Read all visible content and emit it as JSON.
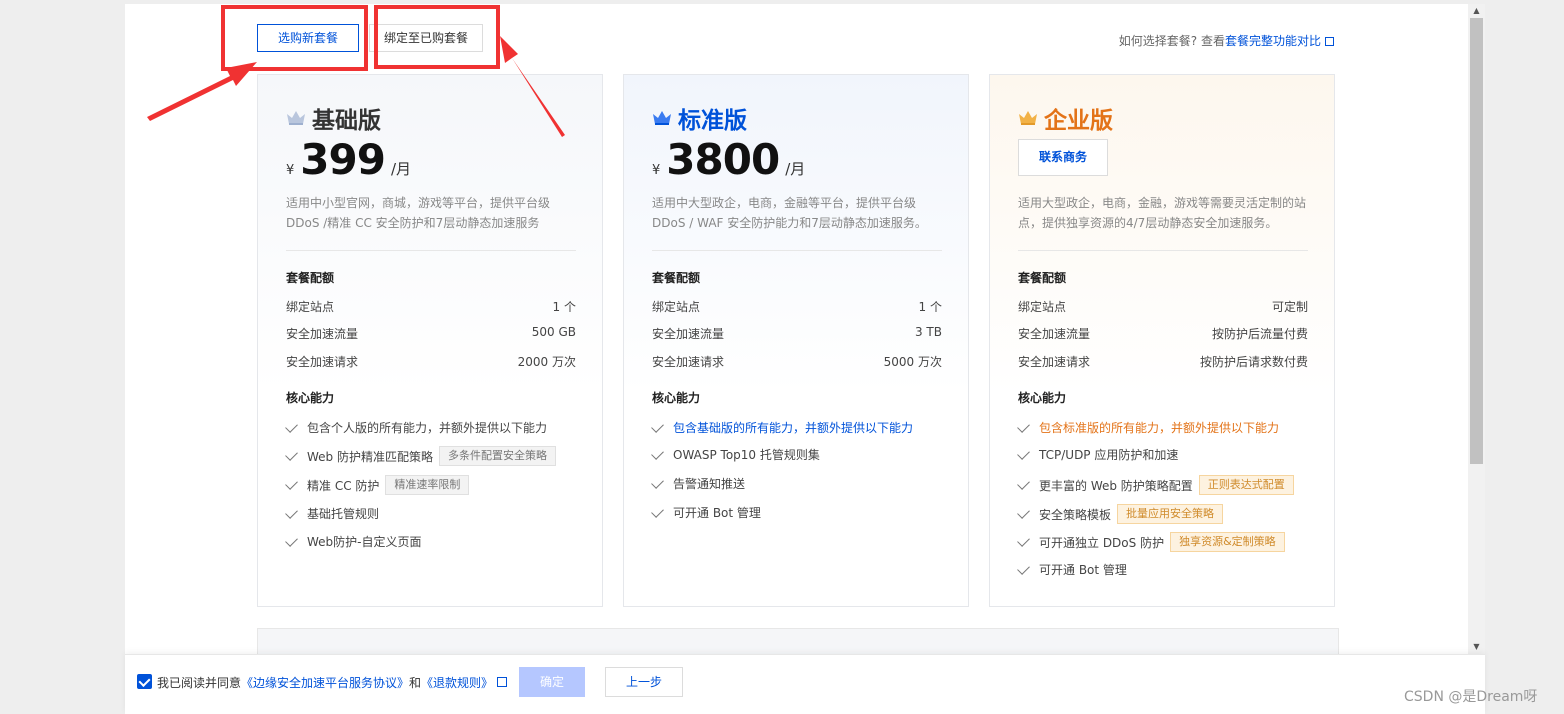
{
  "tabs": {
    "new_plan": "选购新套餐",
    "bind_plan": "绑定至已购套餐"
  },
  "help": {
    "prefix": "如何选择套餐? 查看",
    "link": "套餐完整功能对比"
  },
  "plans": [
    {
      "name": "基础版",
      "currency": "¥",
      "price": "399",
      "unit": "/月",
      "desc": "适用中小型官网，商城，游戏等平台，提供平台级 DDoS /精准 CC 安全防护和7层动静态加速服务",
      "quota_title": "套餐配额",
      "quota": [
        {
          "label": "绑定站点",
          "value": "1 个"
        },
        {
          "label": "安全加速流量",
          "value": "500 GB"
        },
        {
          "label": "安全加速请求",
          "value": "2000 万次"
        }
      ],
      "feature_title": "核心能力",
      "features": [
        {
          "text": "包含个人版的所有能力，并额外提供以下能力",
          "tag": ""
        },
        {
          "text": "Web 防护精准匹配策略",
          "tag": "多条件配置安全策略"
        },
        {
          "text": "精准 CC 防护",
          "tag": "精准速率限制"
        },
        {
          "text": "基础托管规则",
          "tag": ""
        },
        {
          "text": "Web防护-自定义页面",
          "tag": ""
        }
      ]
    },
    {
      "name": "标准版",
      "currency": "¥",
      "price": "3800",
      "unit": "/月",
      "desc": "适用中大型政企，电商，金融等平台，提供平台级 DDoS / WAF 安全防护能力和7层动静态加速服务。",
      "quota_title": "套餐配额",
      "quota": [
        {
          "label": "绑定站点",
          "value": "1 个"
        },
        {
          "label": "安全加速流量",
          "value": "3 TB"
        },
        {
          "label": "安全加速请求",
          "value": "5000 万次"
        }
      ],
      "feature_title": "核心能力",
      "features": [
        {
          "text": "包含基础版的所有能力，并额外提供以下能力",
          "tag": ""
        },
        {
          "text": "OWASP Top10 托管规则集",
          "tag": ""
        },
        {
          "text": "告警通知推送",
          "tag": ""
        },
        {
          "text": "可开通 Bot 管理",
          "tag": ""
        }
      ]
    },
    {
      "name": "企业版",
      "contact": "联系商务",
      "desc": "适用大型政企，电商，金融，游戏等需要灵活定制的站点，提供独享资源的4/7层动静态安全加速服务。",
      "quota_title": "套餐配额",
      "quota": [
        {
          "label": "绑定站点",
          "value": "可定制"
        },
        {
          "label": "安全加速流量",
          "value": "按防护后流量付费"
        },
        {
          "label": "安全加速请求",
          "value": "按防护后请求数付费"
        }
      ],
      "feature_title": "核心能力",
      "features": [
        {
          "text": "包含标准版的所有能力，并额外提供以下能力",
          "tag": ""
        },
        {
          "text": "TCP/UDP 应用防护和加速",
          "tag": ""
        },
        {
          "text": "更丰富的 Web 防护策略配置",
          "tag": "正则表达式配置"
        },
        {
          "text": "安全策略模板",
          "tag": "批量应用安全策略"
        },
        {
          "text": "可开通独立 DDoS 防护",
          "tag": "独享资源&定制策略"
        },
        {
          "text": "可开通 Bot 管理",
          "tag": ""
        }
      ]
    }
  ],
  "footer": {
    "agree_prefix": "我已阅读并同意",
    "agree_link1": "《边缘安全加速平台服务协议》",
    "agree_and": "和",
    "agree_link2": "《退款规则》",
    "confirm": "确定",
    "prev": "上一步"
  },
  "watermark": "CSDN @是Dream呀",
  "colors": {
    "primary": "#0052d9",
    "enterprise": "#e37318",
    "annotation": "#f03232"
  }
}
